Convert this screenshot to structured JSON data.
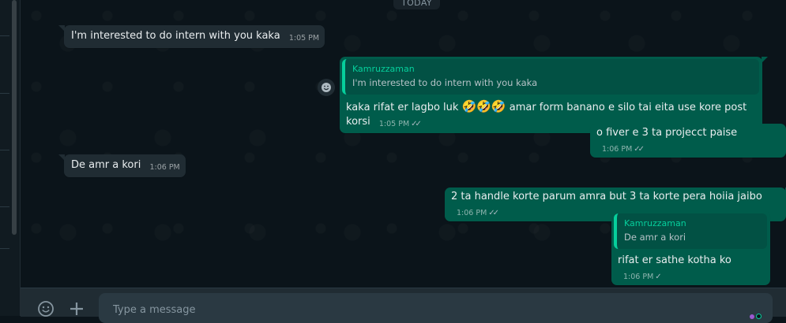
{
  "sidebar": {
    "visible": true
  },
  "chat": {
    "date_label": "TODAY",
    "messages": [
      {
        "dir": "in",
        "text": "I'm interested to do intern with you kaka",
        "time": "1:05 PM"
      },
      {
        "dir": "out",
        "quote_author": "Kamruzzaman",
        "quote_text": "I'm interested to do intern with you kaka",
        "text_before": "kaka rifat er lagbo luk ",
        "emojis": "🤣🤣🤣",
        "text_after": " amar form banano e silo tai eita use kore post korsi",
        "time": "1:05 PM",
        "status": "read"
      },
      {
        "dir": "out",
        "text": "o fiver e 3 ta projecct paise",
        "time": "1:06 PM",
        "status": "read"
      },
      {
        "dir": "in",
        "text": "De amr a kori",
        "time": "1:06 PM"
      },
      {
        "dir": "out",
        "text": "2 ta handle korte parum amra but 3 ta korte pera hoiia jaibo",
        "time": "1:06 PM",
        "status": "read"
      },
      {
        "dir": "out",
        "quote_author": "Kamruzzaman",
        "quote_text": "De amr a kori",
        "text": "rifat er sathe kotha ko",
        "time": "1:06 PM",
        "status": "sent"
      }
    ],
    "react_icon": "smiley-icon"
  },
  "composer": {
    "placeholder": "Type a message",
    "emoji_icon": "emoji-icon",
    "attach_icon": "plus-icon"
  },
  "colors": {
    "background": "#0b141a",
    "incoming": "#202c33",
    "outgoing": "#005c4b",
    "accent": "#06cf9c"
  }
}
